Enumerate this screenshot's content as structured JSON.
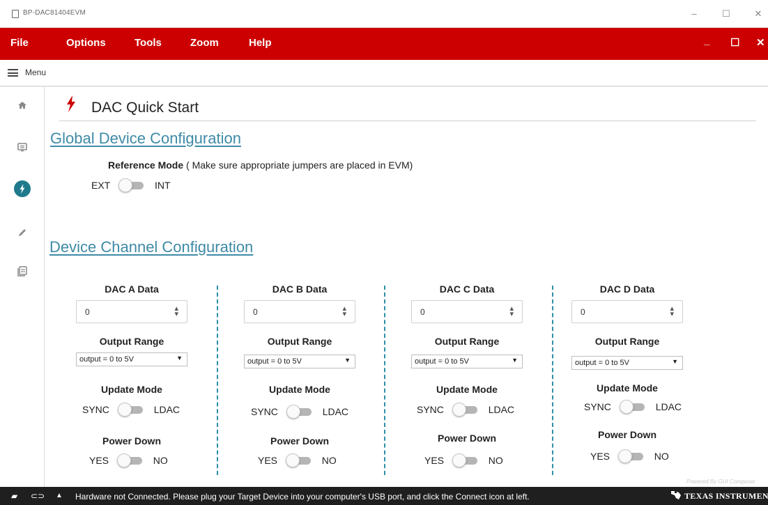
{
  "window": {
    "title": "BP-DAC81404EVM",
    "controls": {
      "minimize": "–",
      "maximize": "☐",
      "close": "✕"
    }
  },
  "menubar": {
    "items": [
      "File",
      "Options",
      "Tools",
      "Zoom",
      "Help"
    ],
    "window_buttons": {
      "minimize": "_",
      "maximize": "☐",
      "close": "✕"
    },
    "background": "#cc0000"
  },
  "menu_row": {
    "label": "Menu"
  },
  "nav_rail": {
    "items": [
      {
        "icon": "home-icon",
        "active": false
      },
      {
        "icon": "message-icon",
        "active": false
      },
      {
        "icon": "quick-start-icon",
        "active": true
      },
      {
        "icon": "pencil-icon",
        "active": false
      },
      {
        "icon": "register-map-icon",
        "active": false
      }
    ],
    "accent": "#1f7a8c"
  },
  "page": {
    "title": "DAC Quick Start",
    "global_section": "Global Device Configuration",
    "reference_mode": {
      "label": "Reference Mode",
      "hint": "( Make sure appropriate jumpers are placed in EVM)",
      "left": "EXT",
      "right": "INT",
      "value": "EXT"
    },
    "channel_section": "Device Channel Configuration",
    "channels": [
      {
        "data_label": "DAC A Data",
        "data_value": "0",
        "range_label": "Output Range",
        "range_value": "output = 0 to 5V",
        "update_label": "Update Mode",
        "update_left": "SYNC",
        "update_right": "LDAC",
        "power_label": "Power Down",
        "power_left": "YES",
        "power_right": "NO"
      },
      {
        "data_label": "DAC B Data",
        "data_value": "0",
        "range_label": "Output Range",
        "range_value": "output = 0 to 5V",
        "update_label": "Update Mode",
        "update_left": "SYNC",
        "update_right": "LDAC",
        "power_label": "Power Down",
        "power_left": "YES",
        "power_right": "NO"
      },
      {
        "data_label": "DAC C Data",
        "data_value": "0",
        "range_label": "Output Range",
        "range_value": "output = 0 to 5V",
        "update_label": "Update Mode",
        "update_left": "SYNC",
        "update_right": "LDAC",
        "power_label": "Power Down",
        "power_left": "YES",
        "power_right": "NO"
      },
      {
        "data_label": "DAC D Data",
        "data_value": "0",
        "range_label": "Output Range",
        "range_value": "output = 0 to 5V",
        "update_label": "Update Mode",
        "update_left": "SYNC",
        "update_right": "LDAC",
        "power_label": "Power Down",
        "power_left": "YES",
        "power_right": "NO"
      }
    ]
  },
  "statusbar": {
    "message": "Hardware not Connected.   Please plug your Target Device into your computer's USB port, and click the Connect icon at left.",
    "brand": "TEXAS INSTRUMENTS",
    "powered": "Powered By GUI Composer"
  },
  "colors": {
    "section_link": "#3e8aa6",
    "divider": "#2d8fa8",
    "statusbar": "#1f1f1f"
  }
}
